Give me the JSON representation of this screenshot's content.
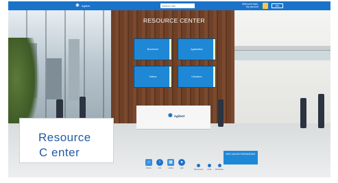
{
  "topbar": {
    "brand": "Agilent",
    "search_placeholder": "Search site",
    "user_name": "Welcome back,",
    "user_sub": "My account",
    "lang": "EN"
  },
  "scene": {
    "heading": "RESOURCE CENTER",
    "panels": [
      "Brochures",
      "Application",
      "Videos",
      "Literature"
    ],
    "desk_brand": "Agilent"
  },
  "caption": {
    "line1": "Resource",
    "line2": "C enter"
  },
  "bottom_nav": {
    "items": [
      "Home",
      "Info",
      "Lobby",
      "Hall"
    ],
    "dots_labels": [
      "Resources",
      "Chat",
      "Briefcase"
    ]
  },
  "small_panel": {
    "text": "VISIT AGILENT RESOURCES"
  },
  "colors": {
    "topbar": "#1a73c9",
    "panel": "#1e88d6",
    "caption_text": "#1f5aa6"
  }
}
